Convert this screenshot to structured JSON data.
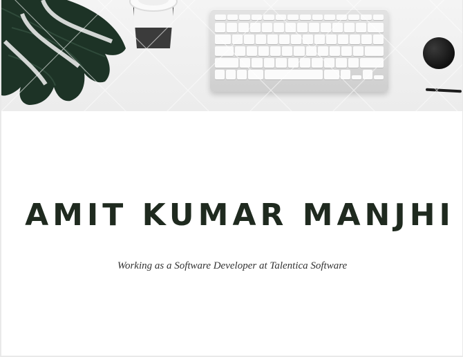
{
  "profile": {
    "name": "AMIT KUMAR MANJHI",
    "tagline": "Working as a Software Developer at Talentica Software"
  },
  "banner": {
    "icons": [
      "leaf-icon",
      "coffee-cup-icon",
      "keyboard-icon",
      "yarn-ball-icon",
      "pen-icon"
    ]
  }
}
